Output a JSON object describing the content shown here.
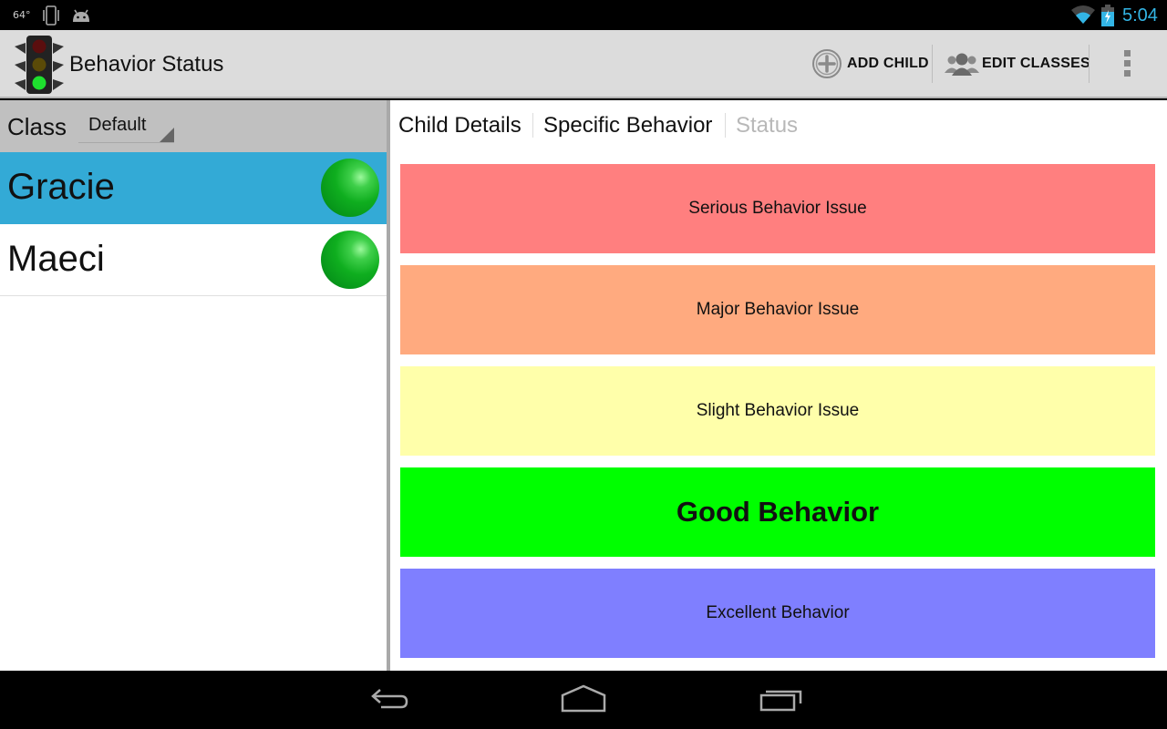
{
  "status_bar": {
    "temperature": "64°",
    "clock": "5:04",
    "icons": [
      "vibrate-icon",
      "android-debug-icon",
      "wifi-icon",
      "battery-charging-icon"
    ]
  },
  "action_bar": {
    "app_icon": "traffic-light-icon",
    "title": "Behavior Status",
    "add_child_label": "ADD CHILD",
    "edit_classes_label": "EDIT CLASSES",
    "overflow_icon": "overflow-menu-icon"
  },
  "left_panel": {
    "class_label": "Class",
    "class_selected": "Default",
    "children": [
      {
        "name": "Gracie",
        "status_color": "#0fae1f",
        "selected": true
      },
      {
        "name": "Maeci",
        "status_color": "#0fae1f",
        "selected": false
      }
    ]
  },
  "right_panel": {
    "tabs": [
      {
        "label": "Child Details",
        "enabled": true
      },
      {
        "label": "Specific Behavior",
        "enabled": true
      },
      {
        "label": "Status",
        "enabled": false
      }
    ],
    "behaviors": [
      {
        "label": "Serious Behavior Issue",
        "color": "#ff7f7f",
        "current": false
      },
      {
        "label": "Major Behavior Issue",
        "color": "#ffaa7f",
        "current": false
      },
      {
        "label": "Slight Behavior Issue",
        "color": "#ffffaa",
        "current": false
      },
      {
        "label": "Good Behavior",
        "color": "#00ff00",
        "current": true
      },
      {
        "label": "Excellent Behavior",
        "color": "#7f7fff",
        "current": false
      }
    ]
  },
  "colors": {
    "accent": "#33b5e5",
    "selected_row": "#33aad6",
    "action_bar": "#dcdcdc",
    "class_bar": "#c0c0c0"
  },
  "nav_bar": {
    "buttons": [
      "back-icon",
      "home-icon",
      "recent-apps-icon"
    ]
  }
}
